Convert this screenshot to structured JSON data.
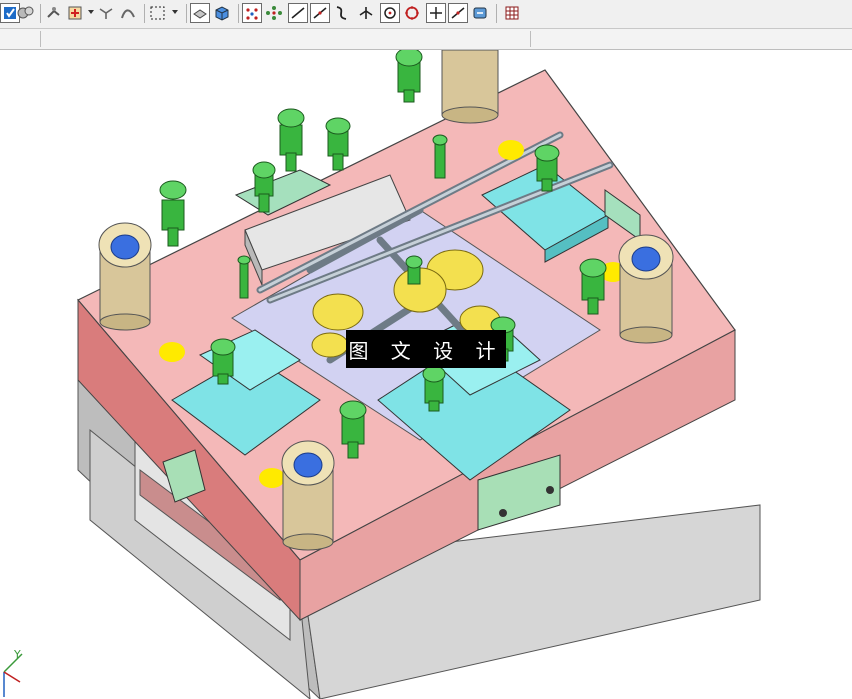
{
  "toolbar": {
    "icons": [
      "select-icon",
      "view-icon",
      "snap-icon",
      "snap-point-icon",
      "quick-pick-icon",
      "path-icon",
      "box-select-icon",
      "shaded-icon",
      "solid-icon",
      "point-icon",
      "grid-point-icon",
      "line-icon",
      "arc-icon",
      "curve-icon",
      "axis-icon",
      "circle-icon",
      "circle-red-icon",
      "cross-icon",
      "diagonal-icon",
      "tag-icon",
      "table-icon"
    ]
  },
  "viewport": {
    "model": "mold-assembly",
    "watermark_text": "图 文 设 计",
    "triad_axis_label": "Y"
  }
}
